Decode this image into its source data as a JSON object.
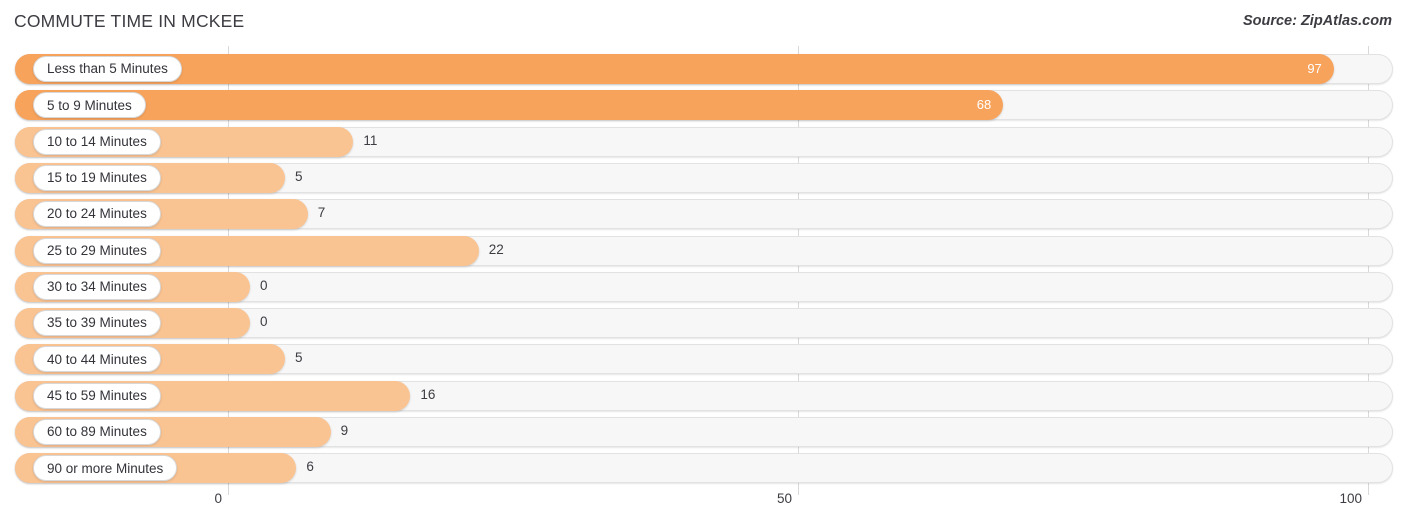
{
  "header": {
    "title": "COMMUTE TIME IN MCKEE",
    "source": "Source: ZipAtlas.com"
  },
  "colors": {
    "bar_strong": "#f7a35c",
    "bar_light": "#fac392",
    "track": "#f7f7f7",
    "grid": "#d9d9d9",
    "text": "#3c3c42"
  },
  "chart_data": {
    "type": "bar",
    "orientation": "horizontal",
    "title": "COMMUTE TIME IN MCKEE",
    "xlabel": "",
    "ylabel": "",
    "xlim": [
      0,
      100
    ],
    "ticks": [
      0,
      50,
      100
    ],
    "tick_labels": [
      "0",
      "50",
      "100"
    ],
    "grid": true,
    "legend": "none",
    "categories": [
      "Less than 5 Minutes",
      "5 to 9 Minutes",
      "10 to 14 Minutes",
      "15 to 19 Minutes",
      "20 to 24 Minutes",
      "25 to 29 Minutes",
      "30 to 34 Minutes",
      "35 to 39 Minutes",
      "40 to 44 Minutes",
      "45 to 59 Minutes",
      "60 to 89 Minutes",
      "90 or more Minutes"
    ],
    "values": [
      97,
      68,
      11,
      5,
      7,
      22,
      0,
      0,
      5,
      16,
      9,
      6
    ],
    "value_labels": [
      "97",
      "68",
      "11",
      "5",
      "7",
      "22",
      "0",
      "0",
      "5",
      "16",
      "9",
      "6"
    ]
  },
  "rows": [
    {
      "label": "Less than 5 Minutes",
      "value": 97,
      "value_label": "97",
      "inside": true,
      "strong": true
    },
    {
      "label": "5 to 9 Minutes",
      "value": 68,
      "value_label": "68",
      "inside": true,
      "strong": true
    },
    {
      "label": "10 to 14 Minutes",
      "value": 11,
      "value_label": "11",
      "inside": false,
      "strong": false
    },
    {
      "label": "15 to 19 Minutes",
      "value": 5,
      "value_label": "5",
      "inside": false,
      "strong": false
    },
    {
      "label": "20 to 24 Minutes",
      "value": 7,
      "value_label": "7",
      "inside": false,
      "strong": false
    },
    {
      "label": "25 to 29 Minutes",
      "value": 22,
      "value_label": "22",
      "inside": false,
      "strong": false
    },
    {
      "label": "30 to 34 Minutes",
      "value": 0,
      "value_label": "0",
      "inside": false,
      "strong": false
    },
    {
      "label": "35 to 39 Minutes",
      "value": 0,
      "value_label": "0",
      "inside": false,
      "strong": false
    },
    {
      "label": "40 to 44 Minutes",
      "value": 5,
      "value_label": "5",
      "inside": false,
      "strong": false
    },
    {
      "label": "45 to 59 Minutes",
      "value": 16,
      "value_label": "16",
      "inside": false,
      "strong": false
    },
    {
      "label": "60 to 89 Minutes",
      "value": 9,
      "value_label": "9",
      "inside": false,
      "strong": false
    },
    {
      "label": "90 or more Minutes",
      "value": 6,
      "value_label": "6",
      "inside": false,
      "strong": false
    }
  ]
}
